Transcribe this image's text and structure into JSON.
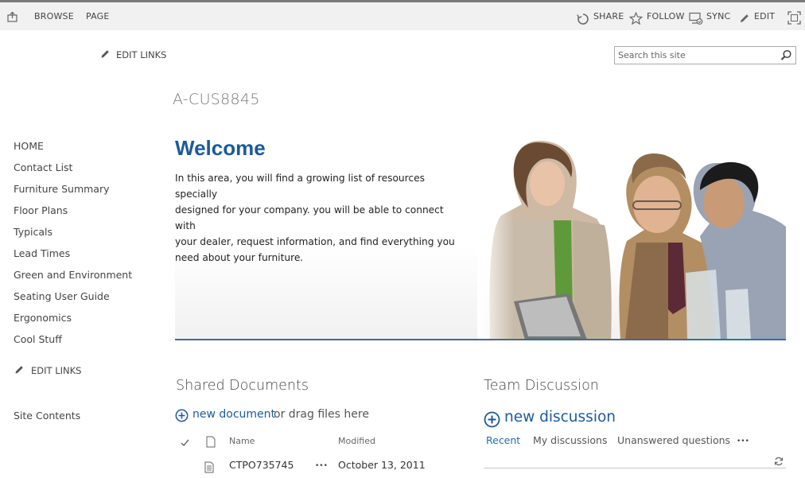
{
  "ribbon": {
    "tabs": [
      {
        "label": "BROWSE"
      },
      {
        "label": "PAGE"
      }
    ],
    "actions": {
      "share": "SHARE",
      "follow": "FOLLOW",
      "sync": "SYNC",
      "edit": "EDIT"
    }
  },
  "top_nav": {
    "edit_links": "EDIT LINKS"
  },
  "search": {
    "placeholder": "Search this site"
  },
  "site": {
    "title": "A-CUS8845"
  },
  "quick_launch": {
    "items": [
      {
        "label": "HOME"
      },
      {
        "label": "Contact List"
      },
      {
        "label": "Furniture Summary"
      },
      {
        "label": "Floor Plans"
      },
      {
        "label": "Typicals"
      },
      {
        "label": "Lead Times"
      },
      {
        "label": "Green and Environment"
      },
      {
        "label": "Seating User Guide"
      },
      {
        "label": "Ergonomics"
      },
      {
        "label": "Cool Stuff"
      }
    ],
    "edit_links": "EDIT LINKS",
    "site_contents": "Site Contents"
  },
  "welcome": {
    "heading": "Welcome",
    "lines": [
      "In this area, you will find a growing list of resources specially",
      "designed for your company. you will be able to connect with",
      "your dealer, request information, and find everything you",
      "need about your furniture."
    ]
  },
  "shared_documents": {
    "title": "Shared Documents",
    "new_link": "new document",
    "new_rest": "or drag files here",
    "columns": {
      "name": "Name",
      "modified": "Modified"
    },
    "rows": [
      {
        "name": "CTPO735745",
        "modified": "October 13, 2011"
      }
    ],
    "ellipsis": "•••"
  },
  "team_discussion": {
    "title": "Team Discussion",
    "new_link": "new discussion",
    "tabs": [
      {
        "label": "Recent"
      },
      {
        "label": "My discussions"
      },
      {
        "label": "Unanswered questions"
      }
    ],
    "more": "•••"
  },
  "colors": {
    "accent": "#1d5a99",
    "link": "#1d6db4",
    "ribbon_bg": "#f1f1f1"
  }
}
